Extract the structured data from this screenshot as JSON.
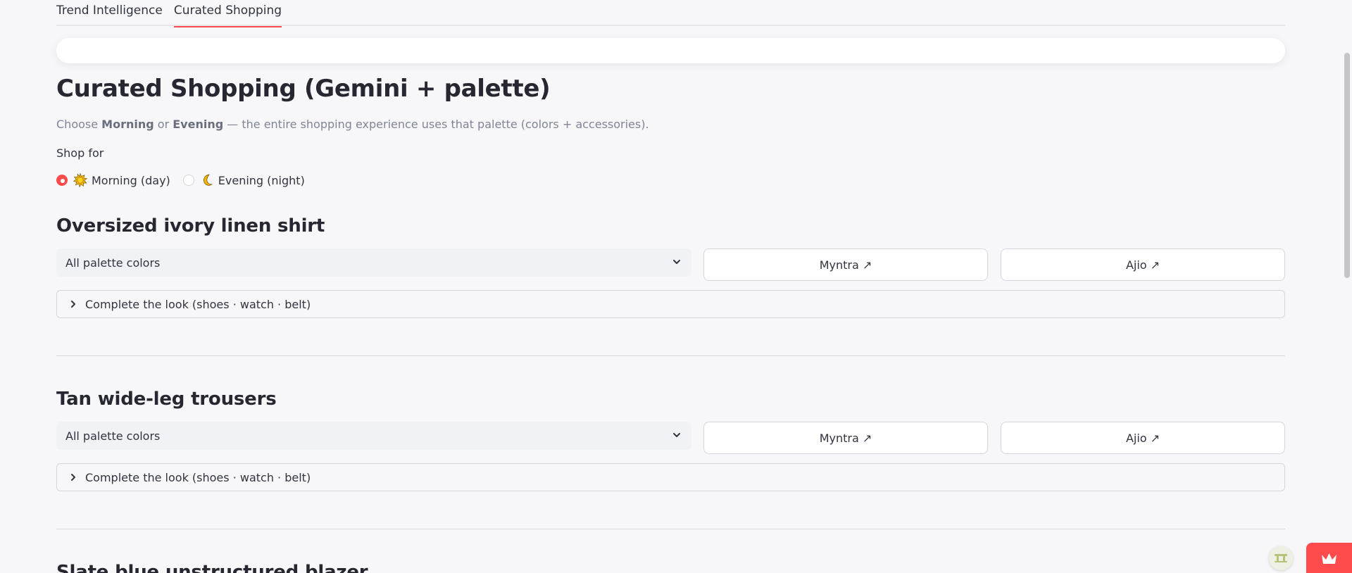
{
  "tabs": [
    {
      "label": "Trend Intelligence"
    },
    {
      "label": "Curated Shopping"
    }
  ],
  "header": {
    "title": "Curated Shopping (Gemini + palette)",
    "subtitle_pre": "Choose ",
    "subtitle_b1": "Morning",
    "subtitle_mid": " or ",
    "subtitle_b2": "Evening",
    "subtitle_post": " — the entire shopping experience uses that palette (colors + accessories)."
  },
  "shop_for": {
    "label": "Shop for",
    "options": [
      {
        "label": "Morning (day)",
        "icon": "sun-icon",
        "selected": true
      },
      {
        "label": "Evening (night)",
        "icon": "moon-icon",
        "selected": false
      }
    ]
  },
  "products": [
    {
      "name": "Oversized ivory linen shirt",
      "color_select": "All palette colors",
      "myntra_label": "Myntra ↗",
      "ajio_label": "Ajio ↗",
      "expander_label": "Complete the look (shoes · watch · belt)"
    },
    {
      "name": "Tan wide-leg trousers",
      "color_select": "All palette colors",
      "myntra_label": "Myntra ↗",
      "ajio_label": "Ajio ↗",
      "expander_label": "Complete the look (shoes · watch · belt)"
    },
    {
      "name": "Slate blue unstructured blazer"
    }
  ],
  "colors": {
    "accent": "#ff4b4b",
    "background": "#f7f7f9",
    "select_bg": "#f0f2f6"
  }
}
